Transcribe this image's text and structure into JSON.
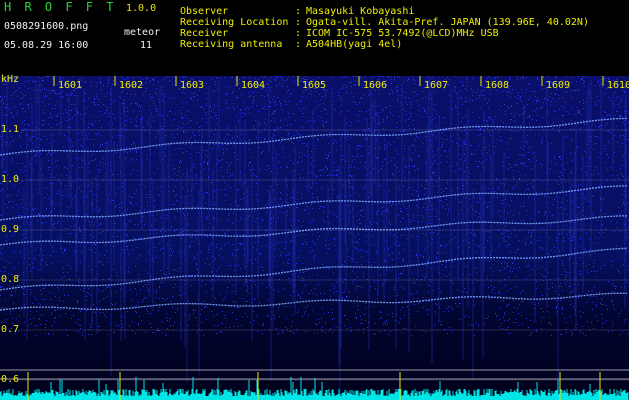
{
  "header": {
    "logo": "H R O F F T",
    "version": "1.0.0",
    "filename": "0508291600.png",
    "datetime": "05.08.29 16:00",
    "meteor_label": "meteor",
    "meteor_count": "11",
    "fields": [
      {
        "label": "Observer",
        "value": "Masayuki Kobayashi"
      },
      {
        "label": "Receiving Location",
        "value": "Ogata-vill. Akita-Pref. JAPAN (139.96E, 40.02N)"
      },
      {
        "label": "Receiver",
        "value": "ICOM IC-575 53.7492(@LCD)MHz USB"
      },
      {
        "label": "Receiving antenna",
        "value": "A504HB(yagi 4el)"
      }
    ]
  },
  "spectrogram": {
    "y_unit": "kHz",
    "y_ticks": [
      "1.1",
      "1.0",
      "0.9",
      "0.8",
      "0.7",
      "0.6"
    ],
    "x_ticks": [
      "1601",
      "1602",
      "1603",
      "1604",
      "1605",
      "1606",
      "1607",
      "1608",
      "1609",
      "1610"
    ],
    "colors": {
      "background": "#00001a",
      "noise": "#2a3cff",
      "signal": "#7fa8ff",
      "grid": "#ffffff",
      "amplitude": "#00e5e5",
      "axis_text": "#f0f000"
    }
  }
}
